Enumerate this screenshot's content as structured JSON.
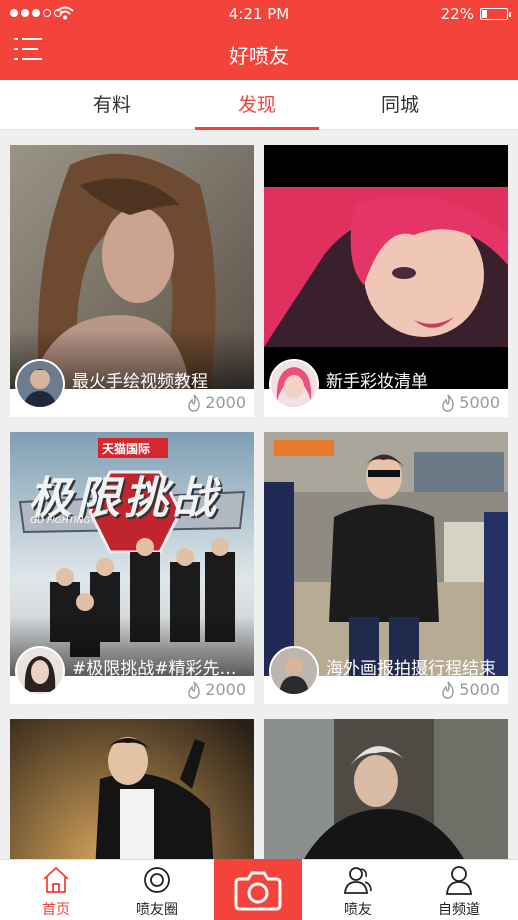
{
  "status_bar": {
    "time": "4:21 PM",
    "battery": "22%",
    "battery_level": 0.22
  },
  "header": {
    "title": "好喷友"
  },
  "tabs": [
    {
      "label": "有料",
      "active": false
    },
    {
      "label": "发现",
      "active": true
    },
    {
      "label": "同城",
      "active": false
    }
  ],
  "cards": [
    {
      "caption": "最火手绘视频教程",
      "count": "2000",
      "image": "photo-woman-painting"
    },
    {
      "caption": "新手彩妆清单",
      "count": "5000",
      "image": "photo-pink-hair"
    },
    {
      "caption": "#极限挑战#精彩先导...",
      "count": "2000",
      "image": "poster-show",
      "poster_brand": "天猫国际",
      "poster_title": "极限挑战",
      "poster_sub": "GO FIGHTING!"
    },
    {
      "caption": "海外画报拍摄行程结束",
      "count": "5000",
      "image": "photo-airport"
    },
    {
      "caption": "",
      "count": "",
      "image": "photo-man-suit"
    },
    {
      "caption": "",
      "count": "",
      "image": "photo-man-street"
    }
  ],
  "bottom_nav": [
    {
      "label": "首页",
      "icon": "home-icon",
      "active": true
    },
    {
      "label": "喷友圈",
      "icon": "circle-icon",
      "active": false
    },
    {
      "label": "",
      "icon": "camera-icon",
      "active": false
    },
    {
      "label": "喷友",
      "icon": "friends-icon",
      "active": false
    },
    {
      "label": "自频道",
      "icon": "profile-icon",
      "active": false
    }
  ],
  "colors": {
    "accent": "#f4433a",
    "count_text": "#9a9a9a"
  }
}
